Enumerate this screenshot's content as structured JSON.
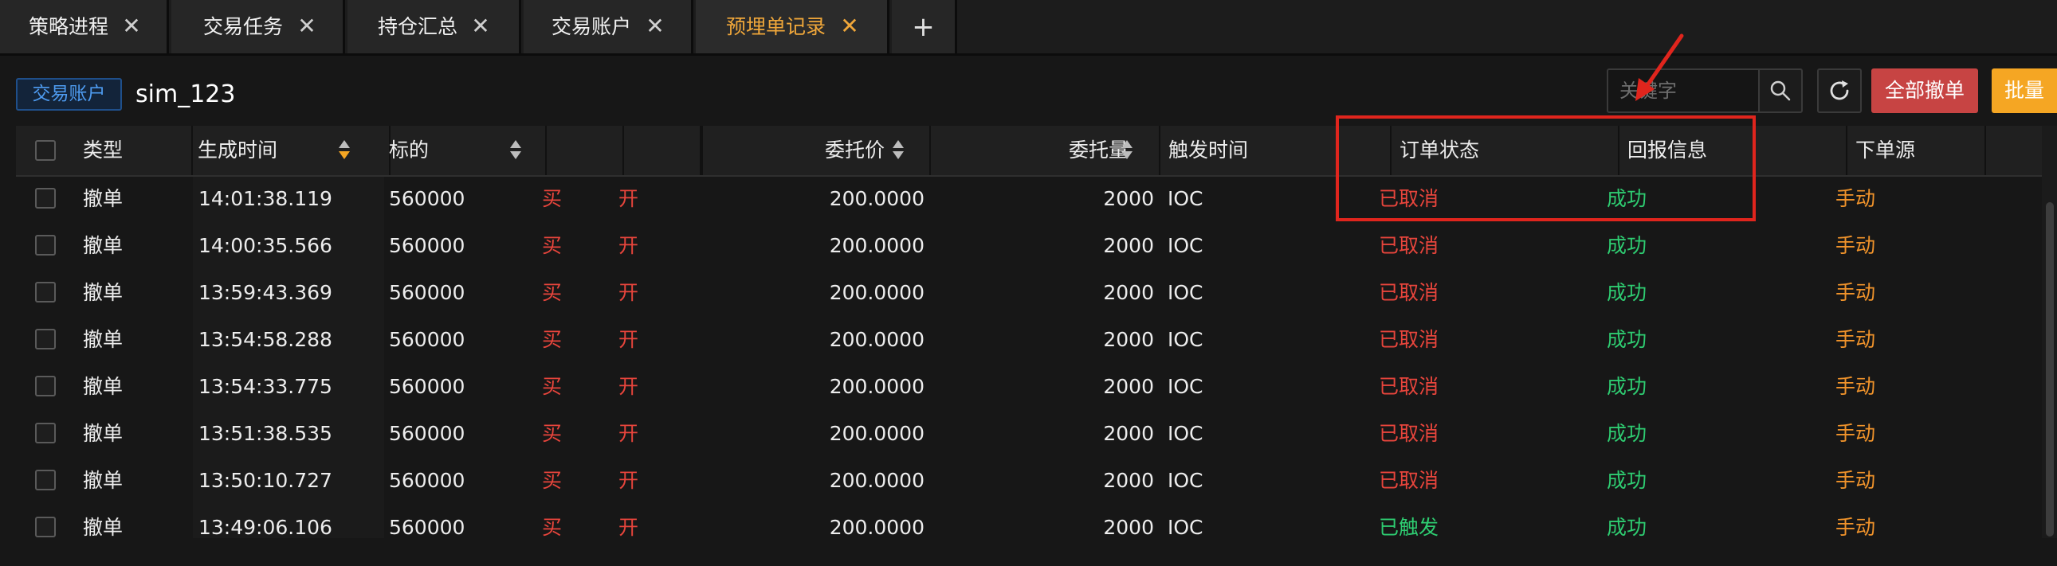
{
  "tabs": [
    {
      "label": "策略进程",
      "active": false
    },
    {
      "label": "交易任务",
      "active": false
    },
    {
      "label": "持仓汇总",
      "active": false
    },
    {
      "label": "交易账户",
      "active": false
    },
    {
      "label": "预埋单记录",
      "active": true
    }
  ],
  "add_tab_label": "+",
  "close_glyph": "✕",
  "toolbar": {
    "account_badge": "交易账户",
    "account_name": "sim_123",
    "search_placeholder": "关键字",
    "cancel_all_label": "全部撤单",
    "batch_label": "批量"
  },
  "icons": {
    "search": "search-icon",
    "refresh": "refresh-icon",
    "sort": "sort-icon",
    "close": "close-icon",
    "add": "plus-icon"
  },
  "colors": {
    "active_tab": "#f0a73a",
    "cancel_button": "#c74443",
    "batch_button": "#f5a623",
    "status_cancelled": "#e8453c",
    "status_triggered": "#2ecc71",
    "reply_success": "#2ecc71",
    "source_manual": "#f0932b",
    "buy_open": "#e8453c",
    "annotation": "#e0251d"
  },
  "table": {
    "columns": {
      "type": "类型",
      "gen_time": "生成时间",
      "symbol": "标的",
      "direction": "",
      "offset": "",
      "blank": "",
      "price": "委托价",
      "qty": "委托量",
      "trigger": "触发时间",
      "status": "订单状态",
      "reply": "回报信息",
      "source": "下单源"
    },
    "sorted_column": "gen_time",
    "rows": [
      {
        "type": "撤单",
        "time": "14:01:38.119",
        "symbol": "560000",
        "dir": "买",
        "offset": "开",
        "price": "200.0000",
        "qty": "2000",
        "trigger": "IOC",
        "status": "已取消",
        "reply": "成功",
        "source": "手动"
      },
      {
        "type": "撤单",
        "time": "14:00:35.566",
        "symbol": "560000",
        "dir": "买",
        "offset": "开",
        "price": "200.0000",
        "qty": "2000",
        "trigger": "IOC",
        "status": "已取消",
        "reply": "成功",
        "source": "手动"
      },
      {
        "type": "撤单",
        "time": "13:59:43.369",
        "symbol": "560000",
        "dir": "买",
        "offset": "开",
        "price": "200.0000",
        "qty": "2000",
        "trigger": "IOC",
        "status": "已取消",
        "reply": "成功",
        "source": "手动"
      },
      {
        "type": "撤单",
        "time": "13:54:58.288",
        "symbol": "560000",
        "dir": "买",
        "offset": "开",
        "price": "200.0000",
        "qty": "2000",
        "trigger": "IOC",
        "status": "已取消",
        "reply": "成功",
        "source": "手动"
      },
      {
        "type": "撤单",
        "time": "13:54:33.775",
        "symbol": "560000",
        "dir": "买",
        "offset": "开",
        "price": "200.0000",
        "qty": "2000",
        "trigger": "IOC",
        "status": "已取消",
        "reply": "成功",
        "source": "手动"
      },
      {
        "type": "撤单",
        "time": "13:51:38.535",
        "symbol": "560000",
        "dir": "买",
        "offset": "开",
        "price": "200.0000",
        "qty": "2000",
        "trigger": "IOC",
        "status": "已取消",
        "reply": "成功",
        "source": "手动"
      },
      {
        "type": "撤单",
        "time": "13:50:10.727",
        "symbol": "560000",
        "dir": "买",
        "offset": "开",
        "price": "200.0000",
        "qty": "2000",
        "trigger": "IOC",
        "status": "已取消",
        "reply": "成功",
        "source": "手动"
      },
      {
        "type": "撤单",
        "time": "13:49:06.106",
        "symbol": "560000",
        "dir": "买",
        "offset": "开",
        "price": "200.0000",
        "qty": "2000",
        "trigger": "IOC",
        "status": "已触发",
        "reply": "成功",
        "source": "手动"
      }
    ]
  }
}
